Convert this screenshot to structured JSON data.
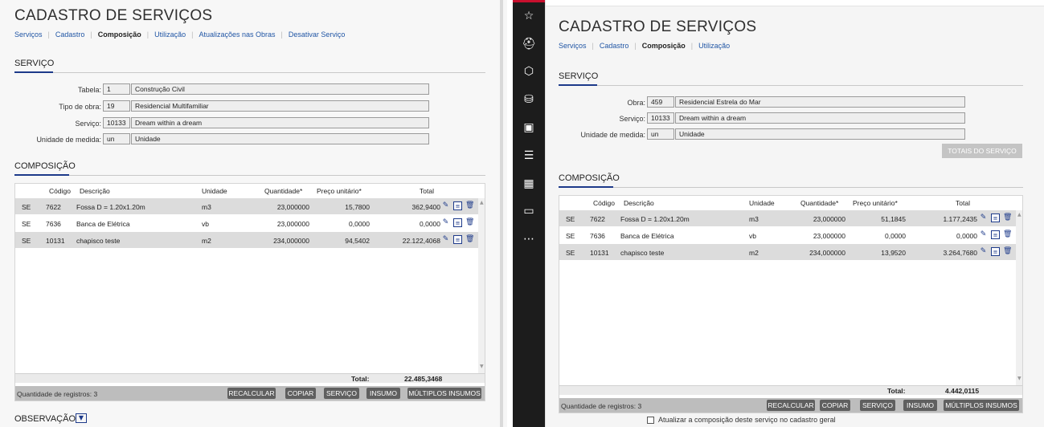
{
  "left": {
    "title": "CADASTRO DE SERVIÇOS",
    "tabs": [
      "Serviços",
      "Cadastro",
      "Composição",
      "Utilização",
      "Atualizações nas Obras",
      "Desativar Serviço"
    ],
    "active_tab": "Composição",
    "servico_heading": "SERVIÇO",
    "fields": [
      {
        "label": "Tabela:",
        "code": "1",
        "value": "Construção Civil"
      },
      {
        "label": "Tipo de obra:",
        "code": "19",
        "value": "Residencial Multifamiliar"
      },
      {
        "label": "Serviço:",
        "code": "10133",
        "value": "Dream within a dream"
      },
      {
        "label": "Unidade de medida:",
        "code": "un",
        "value": "Unidade"
      }
    ],
    "composicao_heading": "COMPOSIÇÃO",
    "columns": [
      "Código",
      "Descrição",
      "Unidade",
      "Quantidade*",
      "Preço unitário*",
      "Total"
    ],
    "rows": [
      {
        "tipo": "SE",
        "codigo": "7622",
        "descricao": "Fossa D = 1.20x1.20m",
        "unidade": "m3",
        "quantidade": "23,000000",
        "preco": "15,7800",
        "total": "362,9400"
      },
      {
        "tipo": "SE",
        "codigo": "7636",
        "descricao": "Banca de Elétrica",
        "unidade": "vb",
        "quantidade": "23,000000",
        "preco": "0,0000",
        "total": "0,0000"
      },
      {
        "tipo": "SE",
        "codigo": "10131",
        "descricao": "chapisco teste",
        "unidade": "m2",
        "quantidade": "234,000000",
        "preco": "94,5402",
        "total": "22.122,4068"
      }
    ],
    "total_label": "Total:",
    "total_value": "22.485,3468",
    "record_count": "Quantidade de registros: 3",
    "buttons": [
      "RECALCULAR",
      "COPIAR",
      "SERVIÇO",
      "INSUMO",
      "MÚLTIPLOS INSUMOS"
    ],
    "observacao": "OBSERVAÇÃO"
  },
  "sidebar": {
    "icons": [
      "star-icon",
      "helmet-icon",
      "cube-icon",
      "coins-icon",
      "document-dollar-icon",
      "report-icon",
      "building-icon",
      "monitor-chart-icon",
      "more-icon"
    ],
    "glyphs": [
      "☆",
      "⛑",
      "⬡",
      "⛁",
      "▣",
      "☰",
      "▦",
      "▭",
      "⋯"
    ]
  },
  "right": {
    "title": "CADASTRO DE SERVIÇOS",
    "tabs": [
      "Serviços",
      "Cadastro",
      "Composição",
      "Utilização"
    ],
    "active_tab": "Composição",
    "servico_heading": "SERVIÇO",
    "fields": [
      {
        "label": "Obra:",
        "code": "459",
        "value": "Residencial Estrela do Mar"
      },
      {
        "label": "Serviço:",
        "code": "10133",
        "value": "Dream within a dream"
      },
      {
        "label": "Unidade de medida:",
        "code": "un",
        "value": "Unidade"
      }
    ],
    "totais_button": "TOTAIS DO SERVIÇO",
    "composicao_heading": "COMPOSIÇÃO",
    "columns": [
      "Código",
      "Descrição",
      "Unidade",
      "Quantidade*",
      "Preço unitário*",
      "Total"
    ],
    "rows": [
      {
        "tipo": "SE",
        "codigo": "7622",
        "descricao": "Fossa D = 1.20x1.20m",
        "unidade": "m3",
        "quantidade": "23,000000",
        "preco": "51,1845",
        "total": "1.177,2435"
      },
      {
        "tipo": "SE",
        "codigo": "7636",
        "descricao": "Banca de Elétrica",
        "unidade": "vb",
        "quantidade": "23,000000",
        "preco": "0,0000",
        "total": "0,0000"
      },
      {
        "tipo": "SE",
        "codigo": "10131",
        "descricao": "chapisco teste",
        "unidade": "m2",
        "quantidade": "234,000000",
        "preco": "13,9520",
        "total": "3.264,7680"
      }
    ],
    "total_label": "Total:",
    "total_value": "4.442,0115",
    "record_count": "Quantidade de registros: 3",
    "buttons": [
      "RECALCULAR",
      "COPIAR",
      "SERVIÇO",
      "INSUMO",
      "MÚLTIPLOS INSUMOS"
    ],
    "checkbox_label": "Atualizar a composição deste serviço no cadastro geral"
  },
  "colors": {
    "accent": "#1d3a8a",
    "link": "#2156a5",
    "sidebar_bg": "#1c1c1c",
    "sidebar_top": "#c8102e",
    "row_shade": "#dcdcdc",
    "button_bg": "#5f5f5f"
  }
}
